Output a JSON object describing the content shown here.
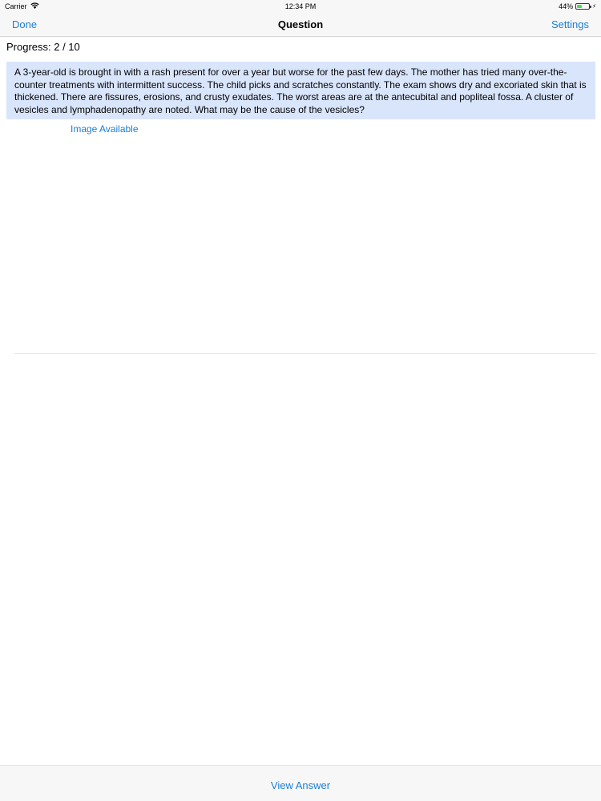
{
  "status_bar": {
    "carrier": "Carrier",
    "wifi_icon": "wifi-icon",
    "time": "12:34 PM",
    "battery_percent": "44%",
    "battery_level": 0.44,
    "battery_color": "#4cd964",
    "charging_icon": "bolt-icon"
  },
  "nav": {
    "done_label": "Done",
    "title": "Question",
    "settings_label": "Settings",
    "accent_color": "#1b7fd6"
  },
  "main": {
    "progress": "Progress: 2 / 10",
    "question": "A 3-year-old is brought in with a rash present for over a year but worse for the past few days. The mother has tried many over-the-counter treatments with intermittent success. The child picks and scratches constantly. The exam shows dry and excoriated skin that is thickened. There are fissures, erosions, and crusty exudates. The worst areas are at the antecubital and popliteal fossa. A cluster of vesicles and lymphadenopathy are noted. What may be the cause of the vesicles?",
    "question_bg_color": "#d9e5fb",
    "image_link": "Image Available"
  },
  "toolbar": {
    "view_answer_label": "View Answer"
  }
}
